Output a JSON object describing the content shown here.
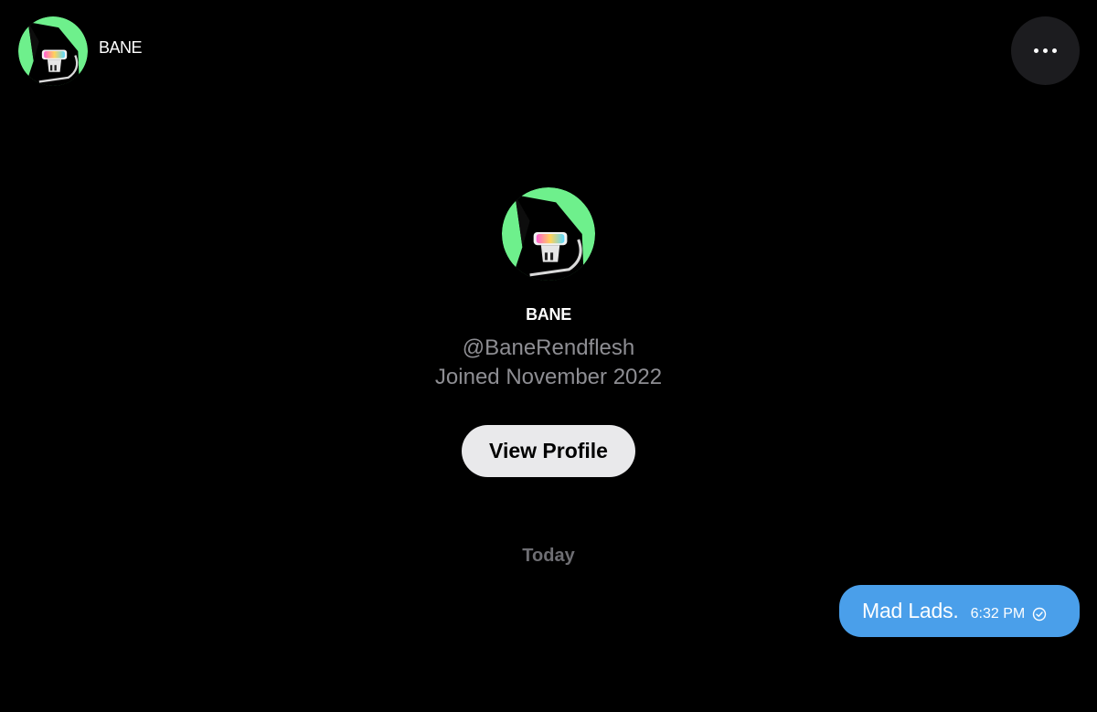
{
  "header": {
    "contact_name": "BANE",
    "avatar_icon": "skull-avatar-icon",
    "more_icon": "more-horizontal-icon"
  },
  "profile": {
    "name": "BANE",
    "handle": "@BaneRendflesh",
    "joined": "Joined November 2022",
    "view_profile_label": "View Profile",
    "avatar_color": "#6ef08c"
  },
  "conversation": {
    "date_separator": "Today",
    "messages": [
      {
        "text": "Mad Lads.",
        "time": "6:32 PM",
        "status_icon": "sent-check-icon",
        "bubble_color": "#4a9fea"
      }
    ]
  },
  "colors": {
    "background": "#000000",
    "muted_text": "#8e8e93",
    "button_bg": "#e9e9eb"
  }
}
